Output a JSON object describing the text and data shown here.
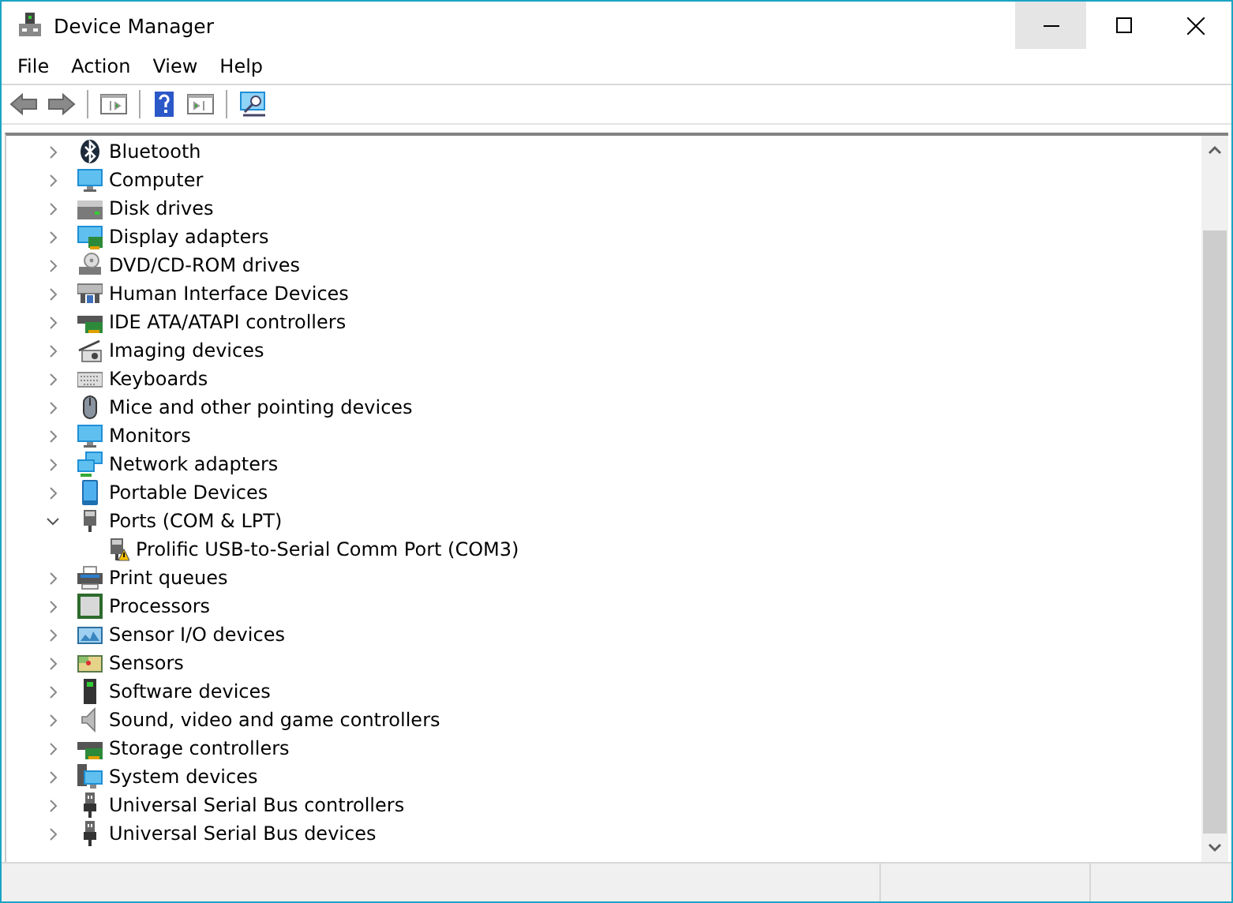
{
  "window": {
    "title": "Device Manager"
  },
  "menu": [
    "File",
    "Action",
    "View",
    "Help"
  ],
  "tree": [
    {
      "label": "Bluetooth",
      "kind": "bluetooth",
      "expanded": false
    },
    {
      "label": "Computer",
      "kind": "computer",
      "expanded": false
    },
    {
      "label": "Disk drives",
      "kind": "disk",
      "expanded": false
    },
    {
      "label": "Display adapters",
      "kind": "display",
      "expanded": false
    },
    {
      "label": "DVD/CD-ROM drives",
      "kind": "dvd",
      "expanded": false
    },
    {
      "label": "Human Interface Devices",
      "kind": "hid",
      "expanded": false
    },
    {
      "label": "IDE ATA/ATAPI controllers",
      "kind": "ide",
      "expanded": false
    },
    {
      "label": "Imaging devices",
      "kind": "imaging",
      "expanded": false
    },
    {
      "label": "Keyboards",
      "kind": "keyboard",
      "expanded": false
    },
    {
      "label": "Mice and other pointing devices",
      "kind": "mouse",
      "expanded": false
    },
    {
      "label": "Monitors",
      "kind": "computer",
      "expanded": false
    },
    {
      "label": "Network adapters",
      "kind": "network",
      "expanded": false
    },
    {
      "label": "Portable Devices",
      "kind": "portable",
      "expanded": false
    },
    {
      "label": "Ports (COM & LPT)",
      "kind": "port",
      "expanded": true,
      "children": [
        {
          "label": "Prolific USB-to-Serial Comm Port (COM3)",
          "kind": "port-warning"
        }
      ]
    },
    {
      "label": "Print queues",
      "kind": "printer",
      "expanded": false
    },
    {
      "label": "Processors",
      "kind": "processor",
      "expanded": false
    },
    {
      "label": "Sensor I/O devices",
      "kind": "sensor-io",
      "expanded": false
    },
    {
      "label": "Sensors",
      "kind": "sensor",
      "expanded": false
    },
    {
      "label": "Software devices",
      "kind": "software",
      "expanded": false
    },
    {
      "label": "Sound, video and game controllers",
      "kind": "sound",
      "expanded": false
    },
    {
      "label": "Storage controllers",
      "kind": "ide",
      "expanded": false
    },
    {
      "label": "System devices",
      "kind": "system",
      "expanded": false
    },
    {
      "label": "Universal Serial Bus controllers",
      "kind": "usb",
      "expanded": false
    },
    {
      "label": "Universal Serial Bus devices",
      "kind": "usb",
      "expanded": false
    }
  ]
}
